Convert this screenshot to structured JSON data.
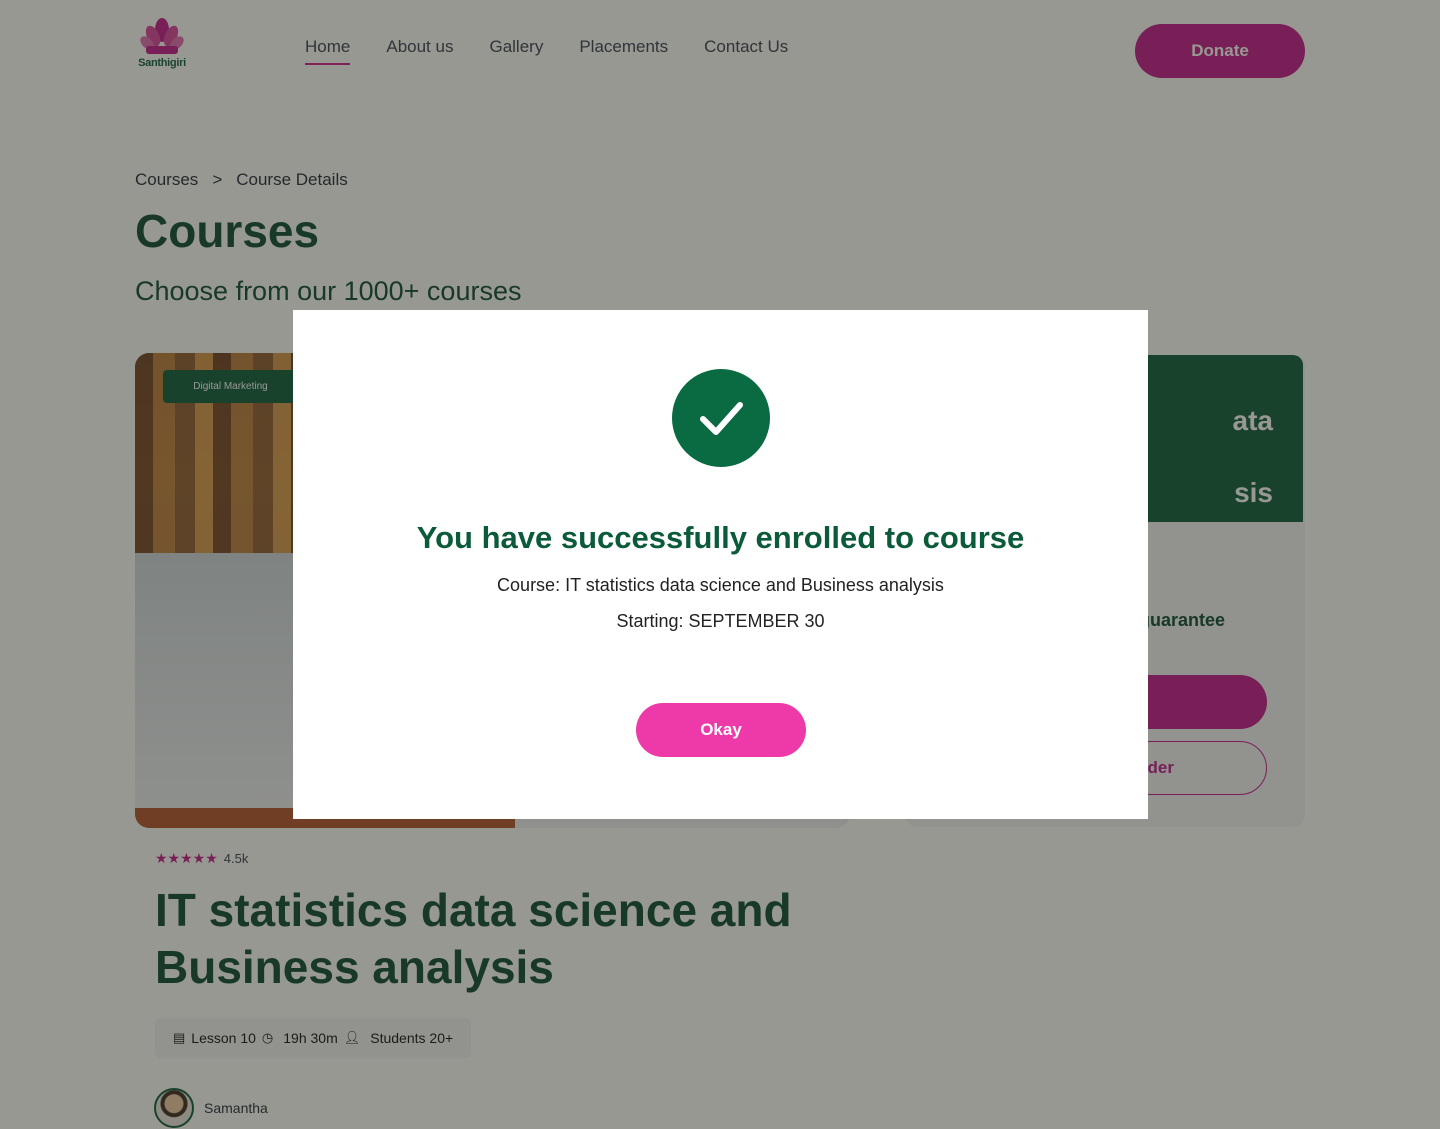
{
  "brand": {
    "logo_text": "Santhigiri"
  },
  "nav": {
    "items": [
      {
        "label": "Home",
        "active": true
      },
      {
        "label": "About us",
        "active": false
      },
      {
        "label": "Gallery",
        "active": false
      },
      {
        "label": "Placements",
        "active": false
      },
      {
        "label": "Contact Us",
        "active": false
      }
    ],
    "donate_label": "Donate"
  },
  "breadcrumb": {
    "items": [
      "Courses",
      "Course Details"
    ],
    "separator": ">"
  },
  "page": {
    "title": "Courses",
    "subtitle": "Choose from our 1000+ courses"
  },
  "hero": {
    "tag": "Digital Marketing"
  },
  "side_card": {
    "title_line1": "ata",
    "title_line2": "sis",
    "feature_text": "guarantee",
    "secondary_button_label": "der"
  },
  "course": {
    "rating_stars": 5,
    "rating_count": "4.5k",
    "title": "IT statistics data science and Business analysis",
    "meta": {
      "lessons": "Lesson 10",
      "duration": "19h 30m",
      "students": "Students 20+"
    },
    "instructor": "Samantha"
  },
  "modal": {
    "title": "You have successfully enrolled to course",
    "course_line": "Course: IT statistics data science and Business analysis",
    "start_line": "Starting: SEPTEMBER 30",
    "okay_label": "Okay"
  },
  "colors": {
    "brand_green": "#0b5b3a",
    "brand_pink": "#c0188a",
    "okay_pink": "#ee3aa8"
  }
}
